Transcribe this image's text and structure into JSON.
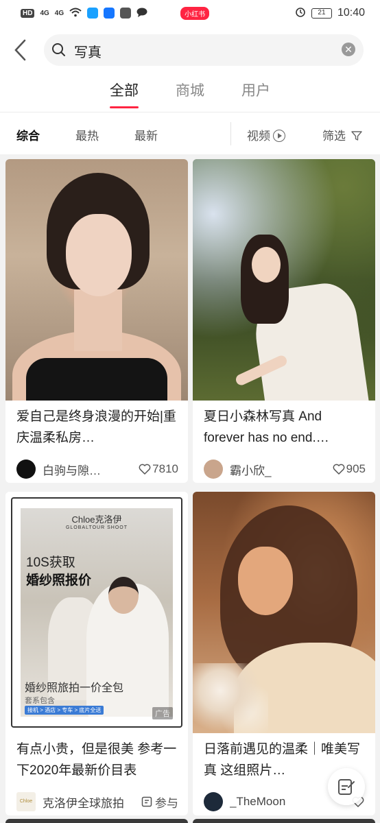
{
  "status_bar": {
    "network": "HD",
    "signal1": "4G",
    "signal2": "4G",
    "app_badge": "小红书",
    "battery": "21",
    "time": "10:40"
  },
  "search": {
    "query": "写真"
  },
  "tabs": [
    "全部",
    "商城",
    "用户"
  ],
  "filters": {
    "sort_general": "综合",
    "sort_hot": "最热",
    "sort_new": "最新",
    "video": "视频",
    "filter": "筛选"
  },
  "cards": [
    {
      "title": "爱自己是终身浪漫的开始|重庆温柔私房…",
      "author": "白驹与隙…",
      "likes": "7810"
    },
    {
      "title": "夏日小森林写真 And forever has no end.…",
      "author": "霸小欣_",
      "likes": "905"
    },
    {
      "title": "有点小贵，但是很美 参考一下2020年最新价目表",
      "author": "克洛伊全球旅拍",
      "likes": "参与",
      "ad": {
        "brand": "Chloe克洛伊",
        "brand_sub": "GLOBALTOUR SHOOT",
        "line1": "10S获取",
        "line2": "婚纱照报价",
        "line3": "婚纱照旅拍一价全包",
        "line4": "套系包含",
        "line5": "接机 > 酒店 > 专车 > 底片全送",
        "ad_label": "广告"
      }
    },
    {
      "title": "日落前遇见的温柔｜唯美写真 这组照片…",
      "author": "_TheMoon",
      "likes": ""
    }
  ],
  "colors": {
    "accent": "#ff2442",
    "background": "#f2f2f2"
  }
}
